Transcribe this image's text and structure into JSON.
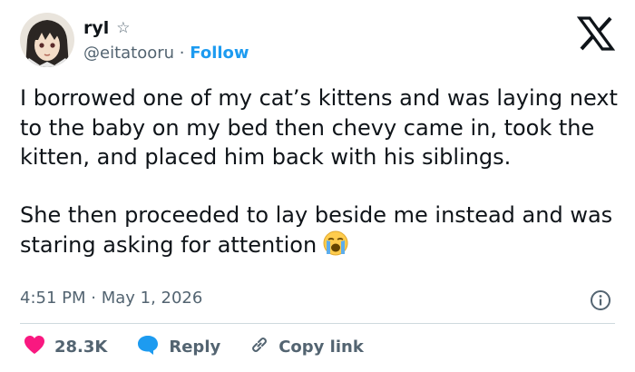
{
  "author": {
    "display_name": "ryl",
    "star_icon": "☆",
    "handle": "@eitatooru",
    "separator": "·",
    "follow_label": "Follow",
    "avatar_icon": "anime-avatar"
  },
  "logo": "x-logo",
  "tweet": {
    "paragraph1": "I borrowed one of my cat’s kittens and was laying next to the baby on my bed then chevy came in, took the kitten, and placed him back with his siblings.",
    "paragraph2": "She then proceeded to lay beside me instead and was staring asking for attention",
    "emoji": "loudly-crying-face-emoji"
  },
  "meta": {
    "timestamp": "4:51 PM · May 1, 2026",
    "info_icon": "info-icon"
  },
  "actions": {
    "likes": "28.3K",
    "reply": "Reply",
    "copy_link": "Copy link"
  },
  "colors": {
    "link": "#1d9bf0",
    "heart": "#f91880",
    "muted": "#536471",
    "text": "#0f1419",
    "divider": "#cfd9de"
  }
}
